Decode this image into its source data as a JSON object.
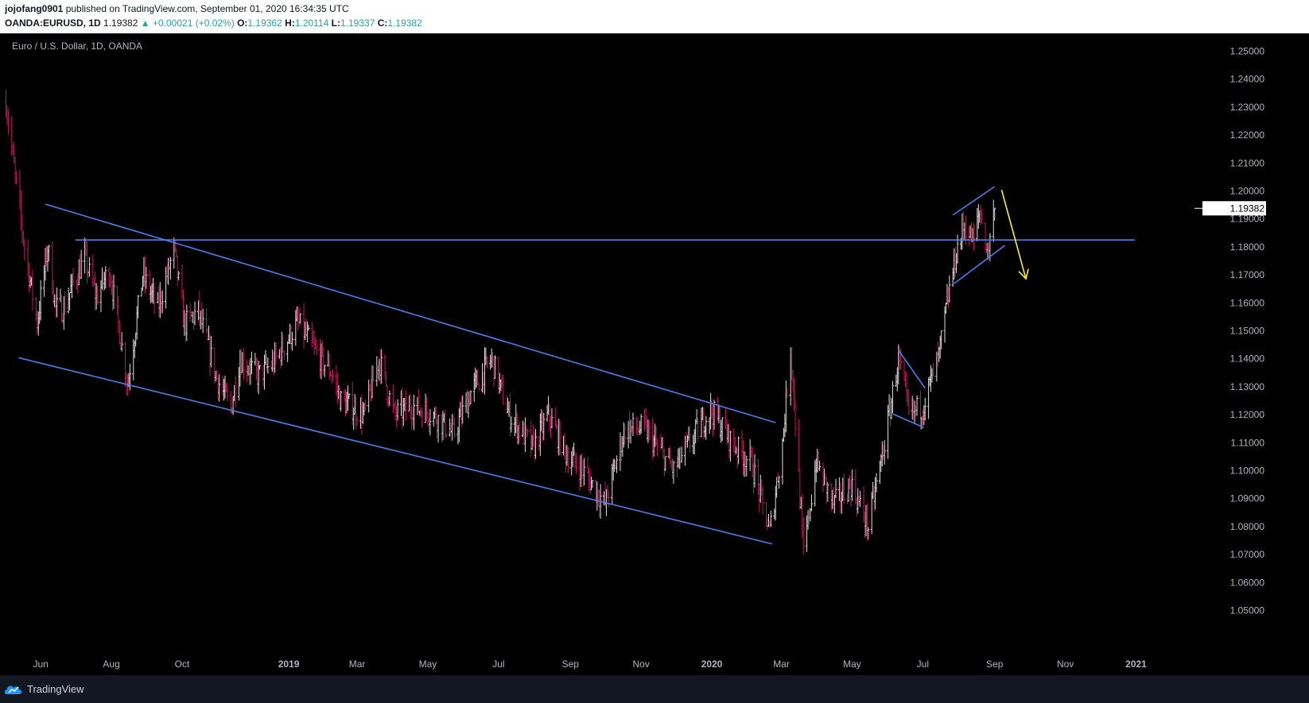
{
  "header": {
    "publisher": "jojofang0901",
    "published_text": "published on TradingView.com, September 01, 2020 16:34:35 UTC",
    "symbol": "OANDA:EURUSD, 1D",
    "last": "1.19382",
    "change": "▲ +0.00021 (+0.02%)",
    "o_label": "O:",
    "o_value": "1.19362",
    "h_label": "H:",
    "h_value": "1.20114",
    "l_label": "L:",
    "l_value": "1.19337",
    "c_label": "C:",
    "c_value": "1.19382"
  },
  "footer": {
    "brand": "TradingView"
  },
  "colors": {
    "up": "#e0e0e0",
    "down": "#c2185b",
    "trendline": "#4a7ff0",
    "arrow": "#ffeb3b",
    "background": "#000000",
    "axis_text": "#b2b5be"
  },
  "chart_data": {
    "type": "ohlc",
    "title": "Euro / U.S. Dollar, 1D, OANDA",
    "ylim": [
      1.045,
      1.255
    ],
    "y_ticks": [
      "1.25000",
      "1.24000",
      "1.23000",
      "1.22000",
      "1.21000",
      "1.20000",
      "1.19000",
      "1.18000",
      "1.17000",
      "1.16000",
      "1.15000",
      "1.14000",
      "1.13000",
      "1.12000",
      "1.11000",
      "1.10000",
      "1.09000",
      "1.08000",
      "1.07000",
      "1.06000",
      "1.05000"
    ],
    "x_ticks": [
      {
        "label": "Jun",
        "date": "2018-06-01",
        "bold": false
      },
      {
        "label": "Aug",
        "date": "2018-08-01",
        "bold": false
      },
      {
        "label": "Oct",
        "date": "2018-10-01",
        "bold": false
      },
      {
        "label": "2019",
        "date": "2019-01-01",
        "bold": true
      },
      {
        "label": "Mar",
        "date": "2019-03-01",
        "bold": false
      },
      {
        "label": "May",
        "date": "2019-05-01",
        "bold": false
      },
      {
        "label": "Jul",
        "date": "2019-07-01",
        "bold": false
      },
      {
        "label": "Sep",
        "date": "2019-09-01",
        "bold": false
      },
      {
        "label": "Nov",
        "date": "2019-11-01",
        "bold": false
      },
      {
        "label": "2020",
        "date": "2020-01-01",
        "bold": true
      },
      {
        "label": "Mar",
        "date": "2020-03-01",
        "bold": false
      },
      {
        "label": "May",
        "date": "2020-05-01",
        "bold": false
      },
      {
        "label": "Jul",
        "date": "2020-07-01",
        "bold": false
      },
      {
        "label": "Sep",
        "date": "2020-09-01",
        "bold": false
      },
      {
        "label": "Nov",
        "date": "2020-11-01",
        "bold": false
      },
      {
        "label": "2021",
        "date": "2021-01-01",
        "bold": true
      }
    ],
    "last_price_label": "1.19382",
    "last_price": 1.19382,
    "price_path": [
      [
        "2018-05-02",
        1.232
      ],
      [
        "2018-05-10",
        1.205
      ],
      [
        "2018-05-18",
        1.18
      ],
      [
        "2018-05-29",
        1.153
      ],
      [
        "2018-06-07",
        1.18
      ],
      [
        "2018-06-14",
        1.158
      ],
      [
        "2018-06-21",
        1.158
      ],
      [
        "2018-06-28",
        1.166
      ],
      [
        "2018-07-09",
        1.176
      ],
      [
        "2018-07-19",
        1.162
      ],
      [
        "2018-07-30",
        1.172
      ],
      [
        "2018-08-06",
        1.155
      ],
      [
        "2018-08-15",
        1.131
      ],
      [
        "2018-08-28",
        1.17
      ],
      [
        "2018-09-10",
        1.158
      ],
      [
        "2018-09-24",
        1.179
      ],
      [
        "2018-10-03",
        1.152
      ],
      [
        "2018-10-15",
        1.157
      ],
      [
        "2018-10-31",
        1.133
      ],
      [
        "2018-11-12",
        1.122
      ],
      [
        "2018-11-20",
        1.14
      ],
      [
        "2018-12-05",
        1.134
      ],
      [
        "2018-12-18",
        1.138
      ],
      [
        "2019-01-09",
        1.153
      ],
      [
        "2019-01-25",
        1.142
      ],
      [
        "2019-02-07",
        1.135
      ],
      [
        "2019-02-15",
        1.125
      ],
      [
        "2019-03-07",
        1.12
      ],
      [
        "2019-03-20",
        1.14
      ],
      [
        "2019-04-02",
        1.12
      ],
      [
        "2019-04-18",
        1.123
      ],
      [
        "2019-05-06",
        1.12
      ],
      [
        "2019-05-23",
        1.113
      ],
      [
        "2019-06-07",
        1.128
      ],
      [
        "2019-06-25",
        1.14
      ],
      [
        "2019-07-10",
        1.12
      ],
      [
        "2019-07-31",
        1.108
      ],
      [
        "2019-08-13",
        1.12
      ],
      [
        "2019-08-28",
        1.106
      ],
      [
        "2019-09-12",
        1.1
      ],
      [
        "2019-10-01",
        1.088
      ],
      [
        "2019-10-18",
        1.115
      ],
      [
        "2019-11-04",
        1.115
      ],
      [
        "2019-11-29",
        1.1
      ],
      [
        "2019-12-13",
        1.11
      ],
      [
        "2019-12-31",
        1.122
      ],
      [
        "2020-01-20",
        1.109
      ],
      [
        "2020-02-04",
        1.103
      ],
      [
        "2020-02-20",
        1.078
      ],
      [
        "2020-03-02",
        1.11
      ],
      [
        "2020-03-09",
        1.145
      ],
      [
        "2020-03-20",
        1.07
      ],
      [
        "2020-03-31",
        1.103
      ],
      [
        "2020-04-15",
        1.088
      ],
      [
        "2020-04-30",
        1.095
      ],
      [
        "2020-05-15",
        1.08
      ],
      [
        "2020-05-29",
        1.11
      ],
      [
        "2020-06-10",
        1.14
      ],
      [
        "2020-06-19",
        1.12
      ],
      [
        "2020-07-01",
        1.123
      ],
      [
        "2020-07-15",
        1.141
      ],
      [
        "2020-07-24",
        1.165
      ],
      [
        "2020-07-31",
        1.18
      ],
      [
        "2020-08-06",
        1.188
      ],
      [
        "2020-08-14",
        1.182
      ],
      [
        "2020-08-19",
        1.193
      ],
      [
        "2020-08-26",
        1.178
      ],
      [
        "2020-09-01",
        1.194
      ]
    ],
    "annotations": {
      "horizontal_level": {
        "price": 1.1825,
        "from": "2018-07-01",
        "to": "2020-12-31"
      },
      "channel_upper": {
        "from": [
          "2018-06-05",
          1.1953
        ],
        "to": [
          "2020-02-25",
          1.1172
        ]
      },
      "channel_lower": {
        "from": [
          "2018-05-13",
          1.1404
        ],
        "to": [
          "2020-02-22",
          1.0738
        ]
      },
      "flag_upper": {
        "from": [
          "2020-06-10",
          1.1431
        ],
        "to": [
          "2020-07-03",
          1.1295
        ]
      },
      "flag_lower": {
        "from": [
          "2020-06-05",
          1.1203
        ],
        "to": [
          "2020-07-02",
          1.1154
        ]
      },
      "wedge_upper": {
        "from": [
          "2020-07-27",
          1.1914
        ],
        "to": [
          "2020-09-01",
          1.2016
        ]
      },
      "wedge_lower": {
        "from": [
          "2020-07-28",
          1.1669
        ],
        "to": [
          "2020-09-10",
          1.1806
        ]
      },
      "forecast_arrow": {
        "from": [
          "2020-09-07",
          1.2004
        ],
        "to": [
          "2020-09-28",
          1.1686
        ]
      }
    }
  }
}
